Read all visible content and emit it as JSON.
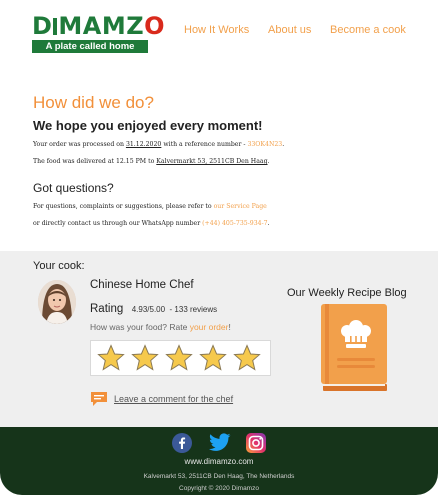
{
  "header": {
    "logo_word_a": "D",
    "logo_word_b": "MAMZ",
    "logo_word_c": "O",
    "logo_tagline": "A plate called home",
    "nav": [
      "How It Works",
      "About us",
      "Become a cook"
    ]
  },
  "intro": {
    "title": "How did we do?",
    "subtitle": "We hope you enjoyed every moment!",
    "processed_prefix": "Your order was processed on ",
    "processed_date": "31.12.2020",
    "processed_mid": " with a reference number - ",
    "reference": "33OK4N23",
    "processed_suffix": ".",
    "delivered_prefix": "The food was delivered at 12.15 PM to ",
    "delivered_address": "Kalvermarkt 53, 2511CB Den Haag",
    "delivered_suffix": ".",
    "questions_title": "Got questions?",
    "questions_prefix": "For questions, complaints or suggestions, please refer to ",
    "service_link": "our Service Page",
    "whatsapp_prefix": "or directly contact us through our WhatsApp number ",
    "whatsapp_number": "(+44) 405-735-934-7",
    "whatsapp_suffix": "."
  },
  "cook": {
    "section_label": "Your cook:",
    "name": "Chinese Home Chef",
    "rating_label": "Rating",
    "rating_value": "4.93/5.00",
    "rating_count": " - 133 reviews",
    "question_prefix": "How was your food? Rate ",
    "question_link": "your order",
    "question_suffix": "!",
    "stars": 5,
    "comment_label": "Leave a comment for the chef"
  },
  "blog": {
    "title": "Our Weekly Recipe Blog"
  },
  "footer": {
    "url": "www.dimamzo.com",
    "address": "Kalvemarkt 53, 2511CB Den Haag, The Netherlands",
    "copyright": "Copyright © 2020 Dimamzo"
  },
  "colors": {
    "accent_orange": "#f2903a",
    "brand_green": "#1f7a3a",
    "footer_bg": "#16341a",
    "section_grey": "#efefef"
  },
  "icons": [
    "fork-icon",
    "facebook-icon",
    "twitter-icon",
    "instagram-icon",
    "star-icon",
    "comment-icon",
    "recipe-book-icon"
  ]
}
